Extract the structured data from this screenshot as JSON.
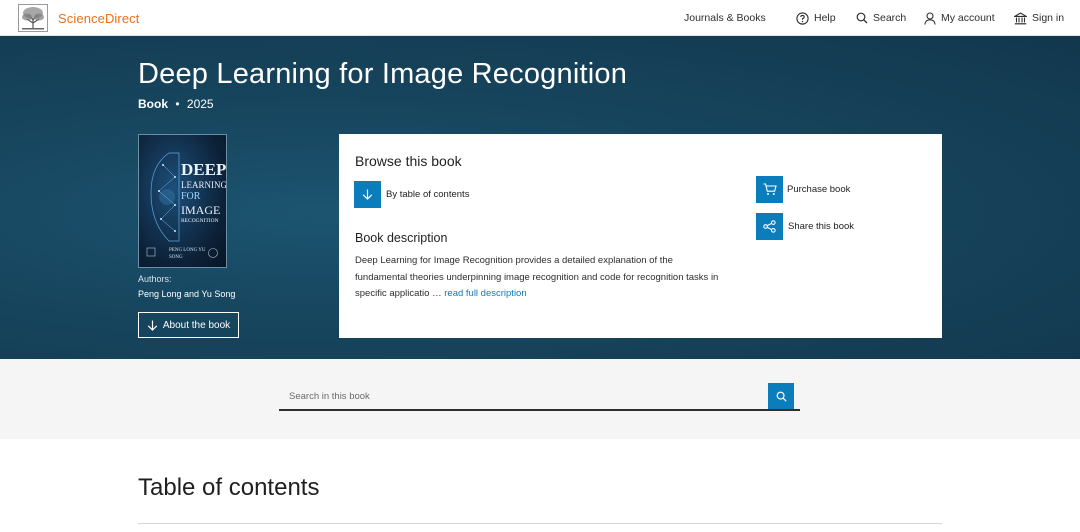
{
  "header": {
    "logo_text": "ScienceDirect",
    "nav": {
      "journals_books": "Journals & Books",
      "help": "Help",
      "search": "Search",
      "my_account": "My account",
      "sign_in": "Sign in"
    }
  },
  "hero": {
    "title": "Deep Learning for Image Recognition",
    "type": "Book",
    "separator": "•",
    "year": "2025",
    "cover": {
      "line1": "DEEP",
      "line2": "LEARNING",
      "line3": "FOR",
      "line4": "IMAGE",
      "line5": "RECOGNITION",
      "authors_line": "PENG LONG YU SONG"
    },
    "authors_label": "Authors:",
    "authors": "Peng Long and Yu Song",
    "about_button": "About the book"
  },
  "browse": {
    "heading": "Browse this book",
    "toc_link": "By table of contents",
    "description_heading": "Book description",
    "description": "Deep Learning for Image Recognition provides a detailed explanation of the fundamental theories underpinning image recognition and code for recognition tasks in specific applicatio …",
    "read_more": "read full description",
    "purchase": "Purchase book",
    "share": "Share this book"
  },
  "search": {
    "placeholder": "Search in this book"
  },
  "toc": {
    "title": "Table of contents"
  },
  "colors": {
    "accent": "#0c7dbb",
    "brand_orange": "#e9711c",
    "hero_bg": "#17465f"
  }
}
